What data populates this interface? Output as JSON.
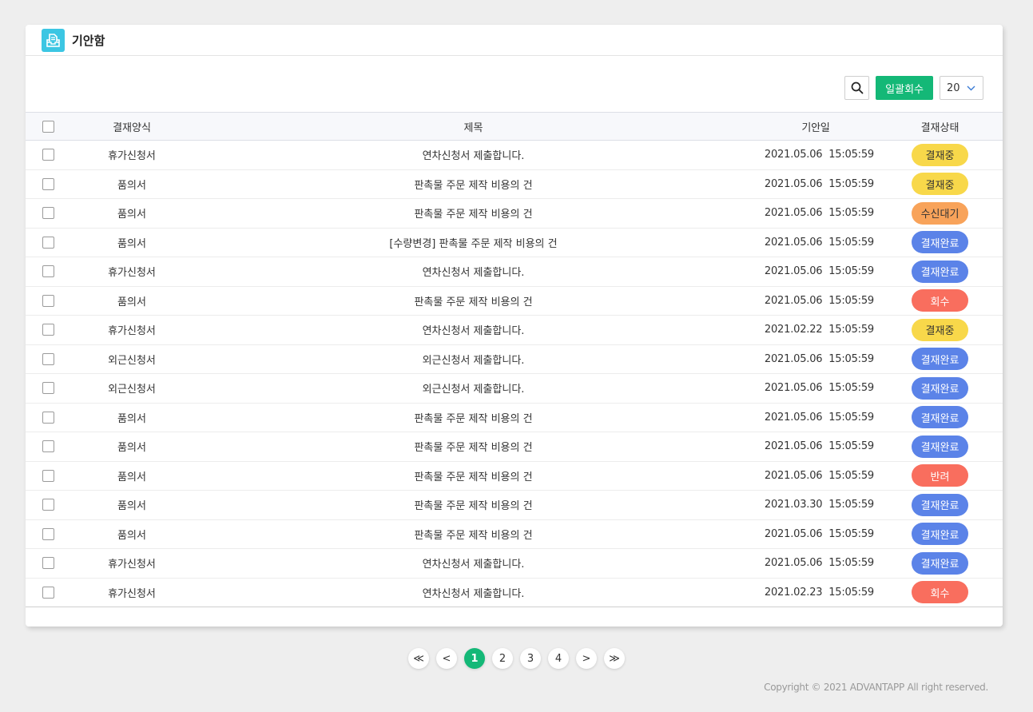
{
  "header": {
    "title": "기안함"
  },
  "toolbar": {
    "bulk_label": "일괄회수",
    "page_size": "20"
  },
  "columns": {
    "form": "결재양식",
    "title": "제목",
    "date": "기안일",
    "status": "결재상태"
  },
  "rows": [
    {
      "form": "휴가신청서",
      "title": "연차신청서 제출합니다.",
      "date": "2021.05.06  15:05:59",
      "status": "결재중"
    },
    {
      "form": "품의서",
      "title": "판촉물 주문 제작 비용의 건",
      "date": "2021.05.06  15:05:59",
      "status": "결재중"
    },
    {
      "form": "품의서",
      "title": "판촉물 주문 제작 비용의 건",
      "date": "2021.05.06  15:05:59",
      "status": "수신대기"
    },
    {
      "form": "품의서",
      "title": "[수량변경] 판촉물 주문 제작 비용의 건",
      "date": "2021.05.06  15:05:59",
      "status": "결재완료"
    },
    {
      "form": "휴가신청서",
      "title": "연차신청서 제출합니다.",
      "date": "2021.05.06  15:05:59",
      "status": "결재완료"
    },
    {
      "form": "품의서",
      "title": "판촉물 주문 제작 비용의 건",
      "date": "2021.05.06  15:05:59",
      "status": "회수"
    },
    {
      "form": "휴가신청서",
      "title": "연차신청서 제출합니다.",
      "date": "2021.02.22  15:05:59",
      "status": "결재중"
    },
    {
      "form": "외근신청서",
      "title": "외근신청서 제출합니다.",
      "date": "2021.05.06  15:05:59",
      "status": "결재완료"
    },
    {
      "form": "외근신청서",
      "title": "외근신청서 제출합니다.",
      "date": "2021.05.06  15:05:59",
      "status": "결재완료"
    },
    {
      "form": "품의서",
      "title": "판촉물 주문 제작 비용의 건",
      "date": "2021.05.06  15:05:59",
      "status": "결재완료"
    },
    {
      "form": "품의서",
      "title": "판촉물 주문 제작 비용의 건",
      "date": "2021.05.06  15:05:59",
      "status": "결재완료"
    },
    {
      "form": "품의서",
      "title": "판촉물 주문 제작 비용의 건",
      "date": "2021.05.06  15:05:59",
      "status": "반려"
    },
    {
      "form": "품의서",
      "title": "판촉물 주문 제작 비용의 건",
      "date": "2021.03.30  15:05:59",
      "status": "결재완료"
    },
    {
      "form": "품의서",
      "title": "판촉물 주문 제작 비용의 건",
      "date": "2021.05.06  15:05:59",
      "status": "결재완료"
    },
    {
      "form": "휴가신청서",
      "title": "연차신청서 제출합니다.",
      "date": "2021.05.06  15:05:59",
      "status": "결재완료"
    },
    {
      "form": "휴가신청서",
      "title": "연차신청서 제출합니다.",
      "date": "2021.02.23  15:05:59",
      "status": "회수"
    }
  ],
  "status_colors": {
    "결재중": {
      "bg": "#f8d84a",
      "fg": "#333333"
    },
    "수신대기": {
      "bg": "#f8a35a",
      "fg": "#333333"
    },
    "결재완료": {
      "bg": "#5b83e8",
      "fg": "#ffffff"
    },
    "회수": {
      "bg": "#f96e5e",
      "fg": "#ffffff"
    },
    "반려": {
      "bg": "#f96e5e",
      "fg": "#ffffff"
    }
  },
  "pagination": {
    "first": "≪",
    "prev": "<",
    "next": ">",
    "last": "≫",
    "pages": [
      "1",
      "2",
      "3",
      "4"
    ],
    "current": "1"
  },
  "footer": {
    "copyright": "Copyright © 2021 ADVANTAPP All right reserved."
  },
  "colors": {
    "accent": "#14b877",
    "header_icon": "#3cc6e3"
  }
}
